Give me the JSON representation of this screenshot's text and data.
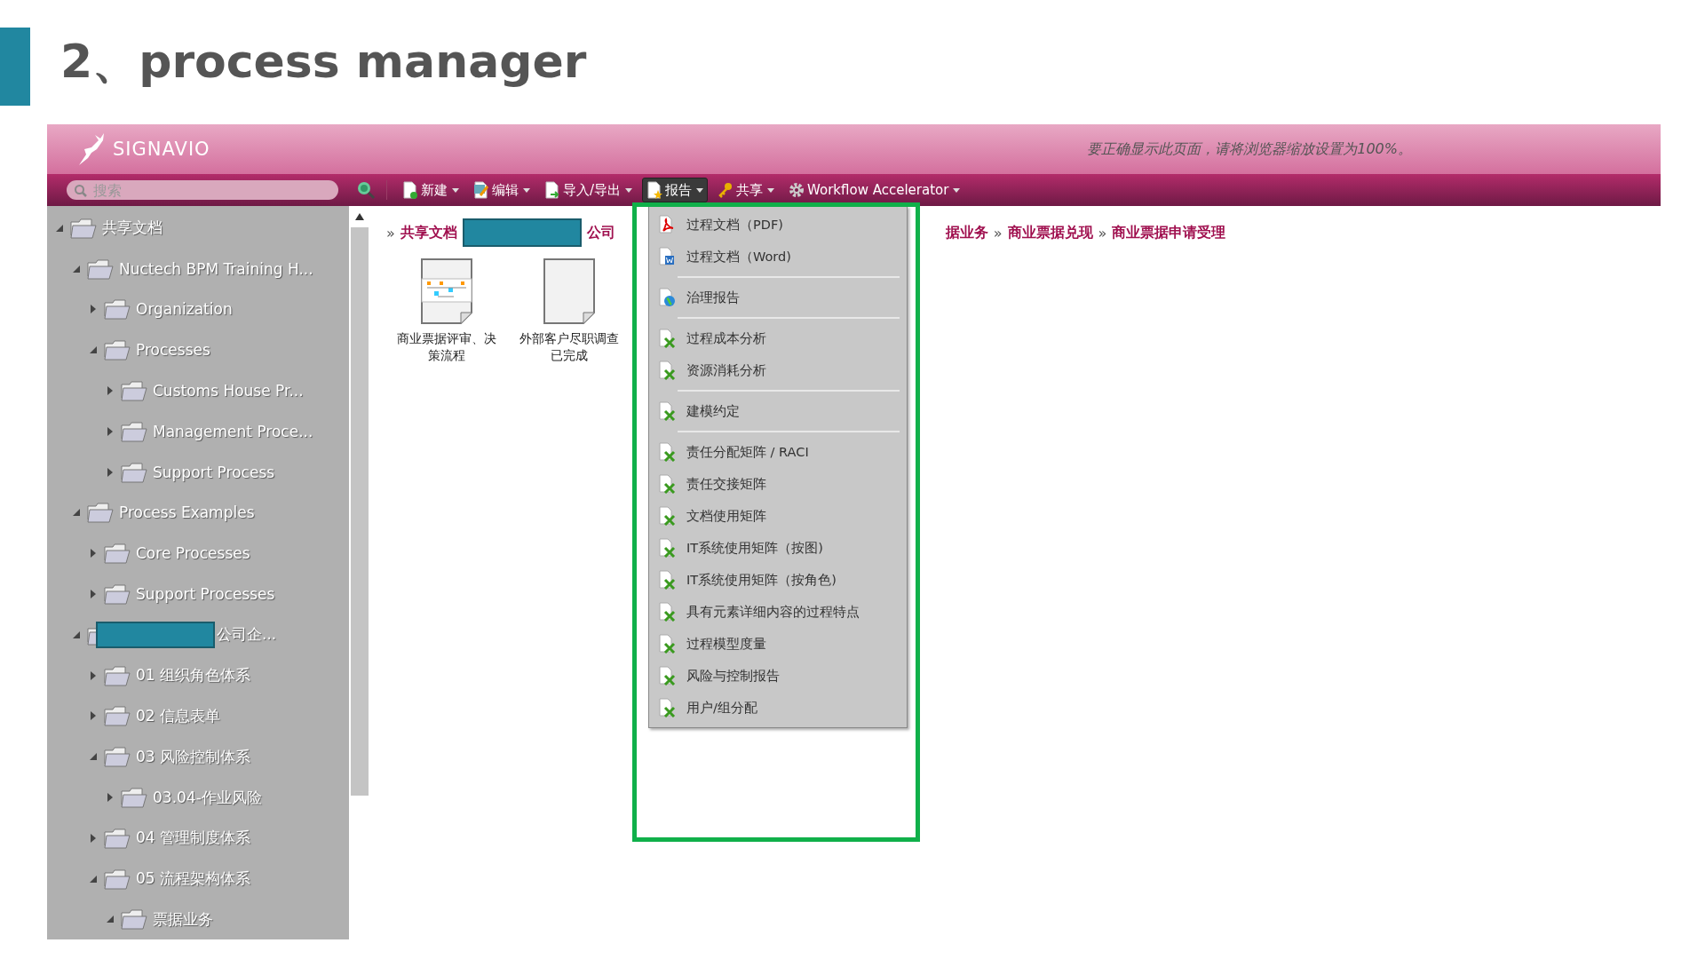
{
  "slide": {
    "title": "2、process manager"
  },
  "app": {
    "logo": "SIGNAVIO",
    "notice": "要正确显示此页面，请将浏览器缩放设置为100%。",
    "search": {
      "placeholder": "搜索"
    },
    "toolbar": [
      {
        "label": "新建",
        "kind": "new",
        "selected": false
      },
      {
        "label": "编辑",
        "kind": "edit",
        "selected": false
      },
      {
        "label": "导入/导出",
        "kind": "import",
        "selected": false
      },
      {
        "label": "报告",
        "kind": "report",
        "selected": true
      },
      {
        "label": "共享",
        "kind": "share",
        "selected": false
      },
      {
        "label": "Workflow Accelerator",
        "kind": "workflow",
        "selected": false
      }
    ],
    "tree": [
      {
        "label": "共享文档",
        "expanded": true,
        "children": [
          {
            "label": "Nuctech BPM Training H...",
            "expanded": true,
            "children": [
              {
                "label": "Organization",
                "expanded": false
              },
              {
                "label": "Processes",
                "expanded": true,
                "children": [
                  {
                    "label": "Customs House Pr...",
                    "expanded": false
                  },
                  {
                    "label": "Management Proce...",
                    "expanded": false
                  },
                  {
                    "label": "Support Process",
                    "expanded": false
                  }
                ]
              }
            ]
          },
          {
            "label": "Process Examples",
            "expanded": true,
            "children": [
              {
                "label": "Core Processes",
                "expanded": false
              },
              {
                "label": "Support Processes",
                "expanded": false
              }
            ]
          },
          {
            "label": "公司企...",
            "redacted": true,
            "expanded": true,
            "children": [
              {
                "label": "01 组织角色体系",
                "expanded": false
              },
              {
                "label": "02 信息表单",
                "expanded": false
              },
              {
                "label": "03 风险控制体系",
                "expanded": true,
                "children": [
                  {
                    "label": "03.04-作业风险",
                    "expanded": false
                  }
                ]
              },
              {
                "label": "04 管理制度体系",
                "expanded": false
              },
              {
                "label": "05 流程架构体系",
                "expanded": true,
                "children": [
                  {
                    "label": "票据业务",
                    "expanded": true
                  }
                ]
              }
            ]
          }
        ]
      }
    ],
    "breadcrumb": [
      [
        {
          "sep": "»",
          "label": "共享文档"
        },
        {
          "redacted": true
        },
        {
          "label": "公司"
        }
      ],
      [
        {
          "label": "据业务"
        },
        {
          "sep": "»",
          "label": "商业票据兑现"
        },
        {
          "sep": "»",
          "label": "商业票据申请受理"
        }
      ]
    ],
    "documents": [
      {
        "label": "商业票据评审、决策流程",
        "kind": "diagram"
      },
      {
        "label": "外部客户尽职调查已完成",
        "kind": "blank"
      }
    ],
    "report_menu": [
      [
        {
          "label": "过程文档（PDF)",
          "kind": "pdf"
        },
        {
          "label": "过程文档（Word)",
          "kind": "word"
        }
      ],
      [
        {
          "label": "治理报告",
          "kind": "globe"
        }
      ],
      [
        {
          "label": "过程成本分析",
          "kind": "excel"
        },
        {
          "label": "资源消耗分析",
          "kind": "excel"
        }
      ],
      [
        {
          "label": "建模约定",
          "kind": "excel"
        }
      ],
      [
        {
          "label": "责任分配矩阵 / RACI",
          "kind": "excel"
        },
        {
          "label": "责任交接矩阵",
          "kind": "excel"
        },
        {
          "label": "文档使用矩阵",
          "kind": "excel"
        },
        {
          "label": "IT系统使用矩阵（按图)",
          "kind": "excel"
        },
        {
          "label": "IT系统使用矩阵（按角色)",
          "kind": "excel"
        },
        {
          "label": "具有元素详细内容的过程特点",
          "kind": "excel"
        },
        {
          "label": "过程模型度量",
          "kind": "excel"
        },
        {
          "label": "风险与控制报告",
          "kind": "excel"
        },
        {
          "label": "用户/组分配",
          "kind": "excel"
        }
      ]
    ]
  }
}
